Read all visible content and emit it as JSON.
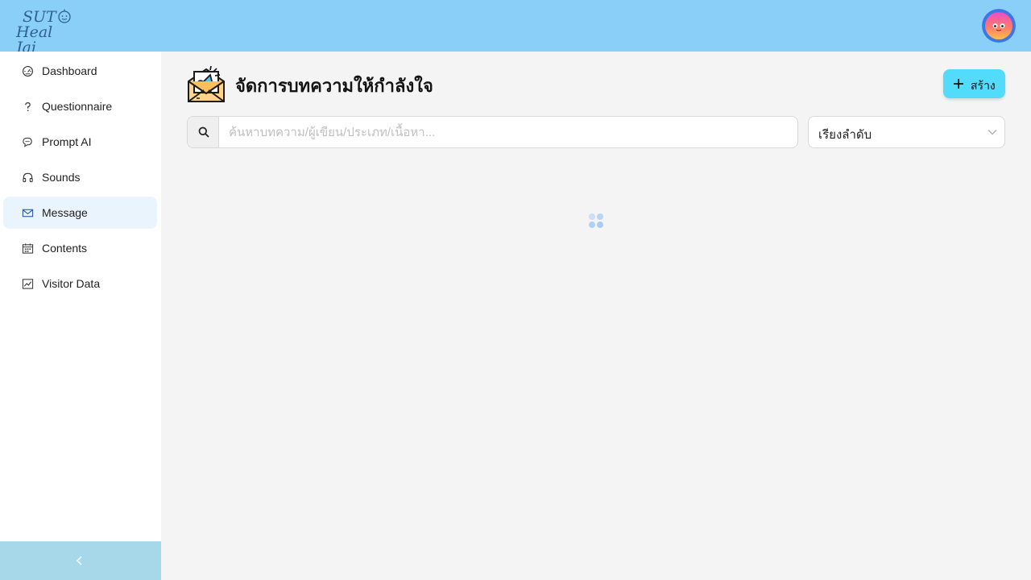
{
  "header": {
    "logo": {
      "line1": "SUT",
      "line2": "Heal Jai"
    }
  },
  "sidebar": {
    "items": [
      {
        "label": "Dashboard",
        "icon": "dashboard-gauge-icon"
      },
      {
        "label": "Questionnaire",
        "icon": "question-mark-icon"
      },
      {
        "label": "Prompt AI",
        "icon": "chat-bubbles-icon"
      },
      {
        "label": "Sounds",
        "icon": "headphones-icon"
      },
      {
        "label": "Message",
        "icon": "mail-icon",
        "active": true
      },
      {
        "label": "Contents",
        "icon": "calendar-icon"
      },
      {
        "label": "Visitor Data",
        "icon": "line-chart-icon"
      }
    ],
    "collapse_icon": "chevron-left-icon"
  },
  "main": {
    "title": "จัดการบทความให้กำลังใจ",
    "create_label": "สร้าง",
    "search": {
      "placeholder": "ค้นหาบทความ/ผู้เขียน/ประเภท/เนื้อหา...",
      "value": ""
    },
    "sort": {
      "label": "เรียงลำดับ"
    }
  },
  "colors": {
    "topbar": "#89cff7",
    "accent_button": "#52dbfa",
    "active_nav": "#eaf4fd",
    "collapse_bar": "#a7d8ea",
    "spinner": "#a9cdf7"
  }
}
